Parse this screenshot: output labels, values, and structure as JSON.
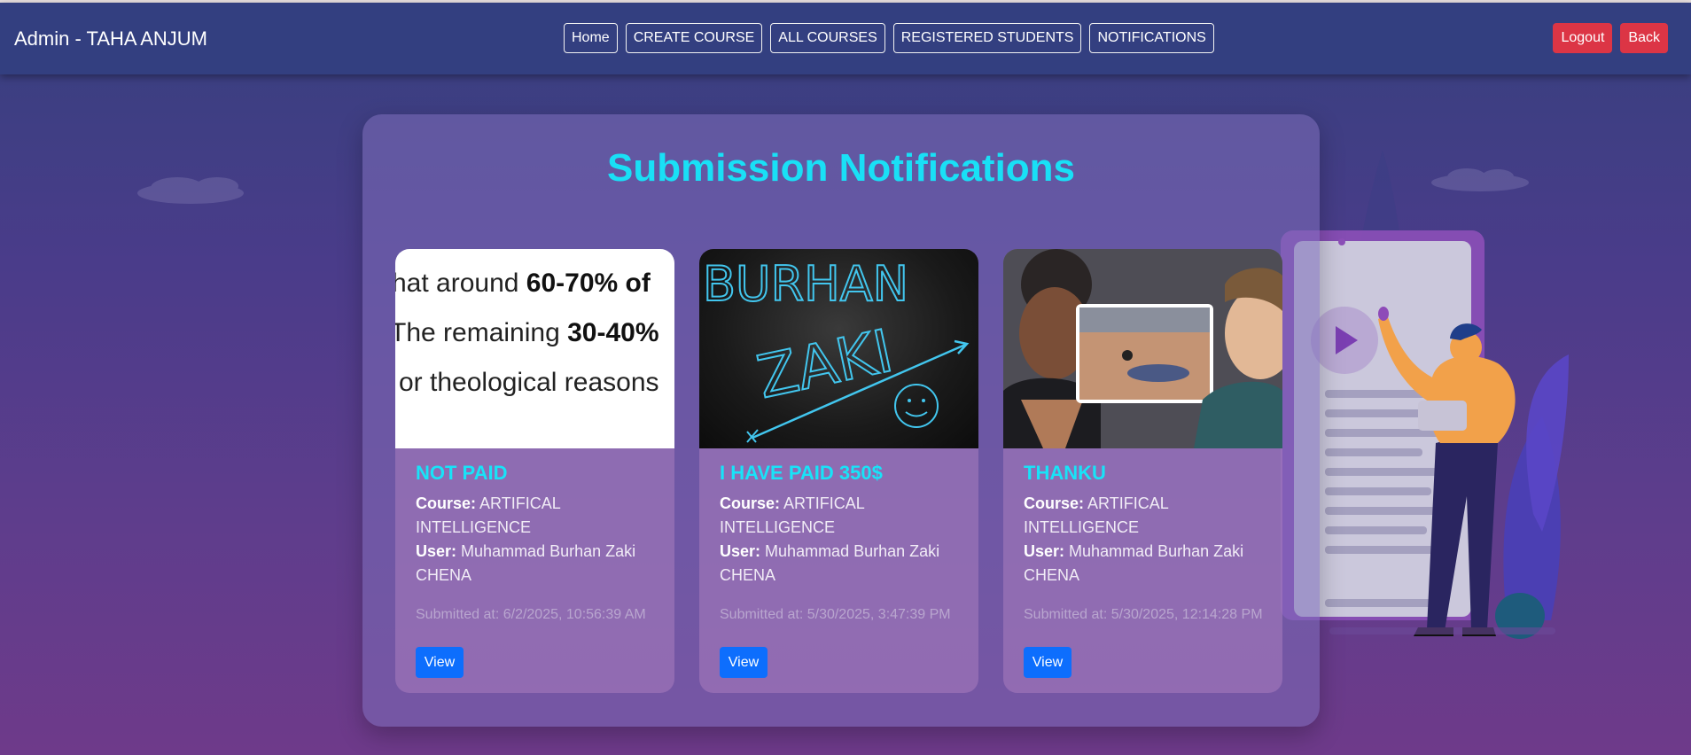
{
  "header": {
    "brand": "Admin - TAHA ANJUM",
    "nav": [
      "Home",
      "CREATE COURSE",
      "ALL COURSES",
      "REGISTERED STUDENTS",
      "NOTIFICATIONS"
    ],
    "logout": "Logout",
    "back": "Back"
  },
  "main": {
    "title": "Submission Notifications",
    "course_label": "Course:",
    "user_label": "User:",
    "view_label": "View",
    "cards": [
      {
        "title": "NOT PAID",
        "course": "ARTIFICAL INTELLIGENCE",
        "user": "Muhammad Burhan Zaki CHENA",
        "submitted": "Submitted at: 6/2/2025, 10:56:39 AM",
        "image_text": {
          "l1a": "hat around ",
          "l1b": "60-70% of",
          "l2a": "The remaining ",
          "l2b": "30-40%",
          "l3": "or theological reasons"
        }
      },
      {
        "title": "I HAVE PAID 350$",
        "course": "ARTIFICAL INTELLIGENCE",
        "user": "Muhammad Burhan Zaki CHENA",
        "submitted": "Submitted at: 5/30/2025, 3:47:39 PM",
        "image_text": {
          "t1": "BURHAN",
          "t2": "ZAKI"
        }
      },
      {
        "title": "THANKU",
        "course": "ARTIFICAL INTELLIGENCE",
        "user": "Muhammad Burhan Zaki CHENA",
        "submitted": "Submitted at: 5/30/2025, 12:14:28 PM"
      }
    ]
  },
  "colors": {
    "accent": "#19e0f6",
    "danger": "#dc3545",
    "primary": "#0d6efd",
    "navbar": "#333f80"
  },
  "icons": [
    "cloud-icon",
    "play-icon"
  ]
}
